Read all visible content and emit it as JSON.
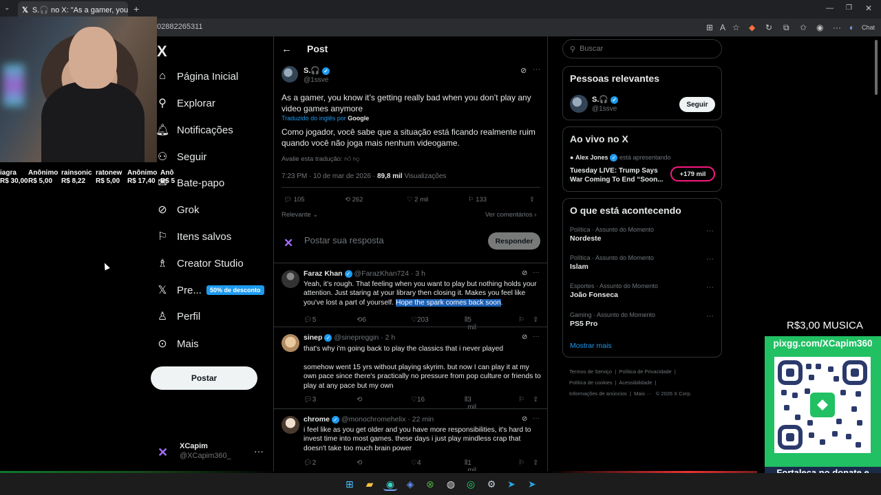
{
  "browser": {
    "tab_title": "S.🎧 no X: \"As a gamer, you know",
    "url": "02882265311",
    "chat_label": "Chat"
  },
  "stream_overlay": {
    "donors": [
      {
        "name": "iagra",
        "amount": "R$ 30,00"
      },
      {
        "name": "Anônimo",
        "amount": "R$ 5,00"
      },
      {
        "name": "rainsonic",
        "amount": "R$ 8,22"
      },
      {
        "name": "ratonew",
        "amount": "R$ 5,00"
      },
      {
        "name": "Anônimo",
        "amount": "R$ 17,40"
      },
      {
        "name": "Anô",
        "amount": "R$ 5"
      }
    ],
    "music_price": "R$3,00 MUSICA",
    "pix_url": "pixgg.com/XCapim360",
    "pix_message": "Fortaleça no donate e envie sua mensagem!"
  },
  "nav": {
    "logo": "X",
    "items": [
      {
        "label": "Página Inicial",
        "icon": "home-icon"
      },
      {
        "label": "Explorar",
        "icon": "search-icon"
      },
      {
        "label": "Notificações",
        "icon": "bell-icon"
      },
      {
        "label": "Seguir",
        "icon": "follow-icon"
      },
      {
        "label": "Bate-papo",
        "icon": "chat-icon"
      },
      {
        "label": "Grok",
        "icon": "grok-icon"
      },
      {
        "label": "Itens salvos",
        "icon": "bookmark-icon"
      },
      {
        "label": "Creator Studio",
        "icon": "creator-studio-icon"
      },
      {
        "label": "Pre...",
        "icon": "x-premium-icon"
      },
      {
        "label": "Perfil",
        "icon": "person-icon"
      },
      {
        "label": "Mais",
        "icon": "more-circle-icon"
      }
    ],
    "premium_badge": "50% de desconto",
    "post_button": "Postar",
    "account": {
      "name": "XCapim",
      "handle": "@XCapim360_"
    }
  },
  "post": {
    "header_title": "Post",
    "author_name": "S.🎧",
    "author_handle": "@1ssve",
    "text": "As a gamer, you know it’s getting really bad when you don’t play any video games anymore",
    "translated_by": "Traduzido do inglês por",
    "translator": "Google",
    "translation": "Como jogador, você sabe que a situação está ficando realmente ruim quando você não joga mais nenhum videogame.",
    "rate_translation": "Avalie esta tradução:",
    "timestamp": "7:23 PM · 10 de mar de 2026 · ",
    "views": "89,8 mil",
    "views_label": "Visualizações",
    "stats": {
      "replies": "105",
      "reposts": "262",
      "likes": "2 mil",
      "bookmarks": "133"
    },
    "sort_label": "Relevante",
    "view_quotes": "Ver comentários",
    "reply_placeholder": "Postar sua resposta",
    "reply_button": "Responder"
  },
  "replies": [
    {
      "name": "Faraz Khan",
      "handle": "@FarazKhan724",
      "time": "· 3 h",
      "text_before": "Yeah, it’s rough. That feeling when you want to play but nothing holds your attention. Just staring at your library then closing it. Makes you feel like you’ve lost a part of yourself. ",
      "text_highlight": "Hope the spark comes back soon",
      "text_after": ".",
      "replies": "5",
      "reposts": "6",
      "likes": "203",
      "views": "5 mil"
    },
    {
      "name": "sinep",
      "handle": "@sinepreggin",
      "time": "· 2 h",
      "text_p1": "that's why i'm going back to play the classics that i never played",
      "text_p2": "somehow went 15 yrs without playing skyrim. but now I can play it at my own pace since there's practically no pressure from pop culture or friends to play at any pace but my own",
      "replies": "3",
      "reposts": "",
      "likes": "16",
      "views": "3 mil"
    },
    {
      "name": "chrome",
      "handle": "@monochromehelix",
      "time": "· 22 min",
      "text": "i feel like as you get older and you have more responsibilities, it's hard to invest time into most games. these days i just play mindless crap that doesn't take too much brain power",
      "replies": "2",
      "reposts": "",
      "likes": "4",
      "views": "1 mil"
    }
  ],
  "sidebar": {
    "search_placeholder": "Buscar",
    "relevant_title": "Pessoas relevantes",
    "relevant_person": {
      "name": "S.🎧",
      "handle": "@1ssve",
      "button": "Seguir"
    },
    "live_title": "Ao vivo no X",
    "live_host": "Alex Jones",
    "live_status": "está apresentando",
    "live_headline": "Tuesday LIVE: Trump Says War Coming To End “Soon...",
    "live_count": "+179 mil",
    "trends_title": "O que está acontecendo",
    "trends": [
      {
        "category": "Política · Assunto do Momento",
        "name": "Nordeste"
      },
      {
        "category": "Política · Assunto do Momento",
        "name": "Islam"
      },
      {
        "category": "Esportes · Assunto do Momento",
        "name": "João Fonseca"
      },
      {
        "category": "Gaming · Assunto do Momento",
        "name": "PS5 Pro"
      }
    ],
    "show_more": "Mostrar mais",
    "footer": [
      "Termos de Serviço",
      "Política de Privacidade",
      "Política de cookies",
      "Acessibilidade",
      "Informações de anúncios",
      "Mais ···",
      "© 2026 X Corp."
    ]
  }
}
